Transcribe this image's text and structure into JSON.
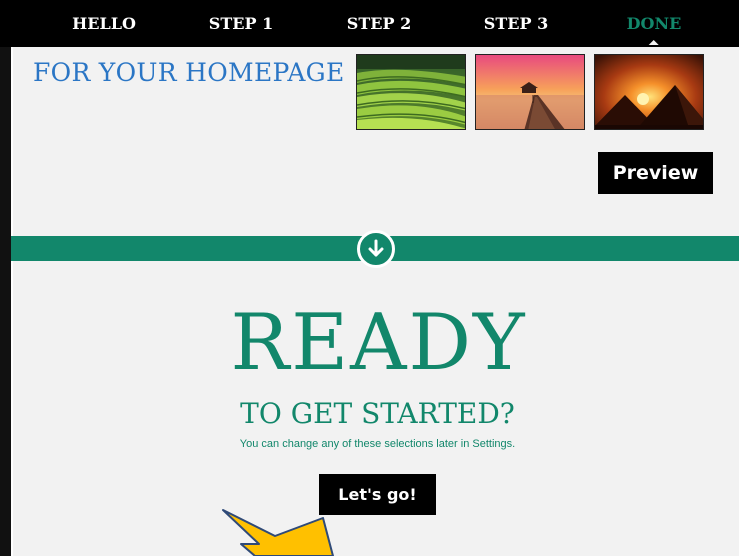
{
  "nav": {
    "items": [
      {
        "label": "HELLO",
        "active": false
      },
      {
        "label": "STEP 1",
        "active": false
      },
      {
        "label": "STEP 2",
        "active": false
      },
      {
        "label": "STEP 3",
        "active": false
      },
      {
        "label": "DONE",
        "active": true
      }
    ]
  },
  "homepage": {
    "title": "FOR YOUR HOMEPAGE",
    "thumbnails": [
      {
        "name": "tea-plantation"
      },
      {
        "name": "pier-sunset"
      },
      {
        "name": "pyramids-sunset"
      }
    ],
    "preview_label": "Preview"
  },
  "divider": {
    "icon": "arrow-down-circle-icon"
  },
  "ready": {
    "headline": "READY",
    "subheadline": "TO GET STARTED?",
    "note": "You can change any of these selections later in Settings.",
    "button_label": "Let's go!"
  },
  "colors": {
    "accent": "#12876b",
    "link_blue": "#2b76c5",
    "nav_bg": "#000000",
    "page_bg": "#f2f2f2",
    "annotation_arrow": "#ffc000"
  }
}
